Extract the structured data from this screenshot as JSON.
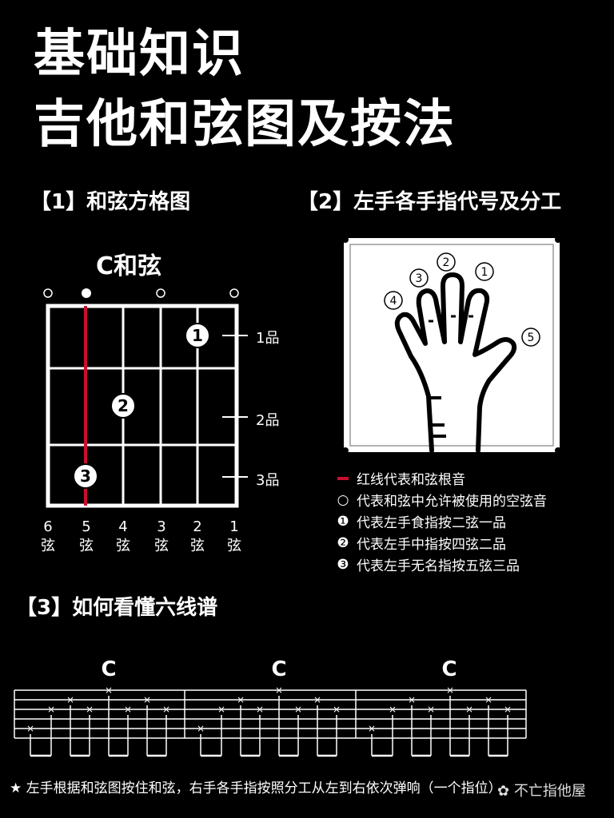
{
  "title": {
    "line1": "基础知识",
    "line2": "吉他和弦图及按法"
  },
  "sections": {
    "s1": "【1】和弦方格图",
    "s2": "【2】左手各手指代号及分工",
    "s3": "【3】如何看懂六线谱"
  },
  "chord": {
    "name": "C和弦",
    "frets": [
      "1品",
      "2品",
      "3品"
    ],
    "strings": [
      {
        "num": "6",
        "label": "弦"
      },
      {
        "num": "5",
        "label": "弦"
      },
      {
        "num": "4",
        "label": "弦"
      },
      {
        "num": "3",
        "label": "弦"
      },
      {
        "num": "2",
        "label": "弦"
      },
      {
        "num": "1",
        "label": "弦"
      }
    ],
    "finger_marks": [
      "1",
      "2",
      "3"
    ]
  },
  "hand": {
    "fingers": [
      "1",
      "2",
      "3",
      "4",
      "5"
    ]
  },
  "legend": [
    {
      "symbol": "red-line",
      "text": "红线代表和弦根音"
    },
    {
      "symbol": "○",
      "text": "代表和弦中允许被使用的空弦音"
    },
    {
      "symbol": "❶",
      "text": "代表左手食指按二弦一品"
    },
    {
      "symbol": "❷",
      "text": "代表左手中指按四弦二品"
    },
    {
      "symbol": "❸",
      "text": "代表左手无名指按五弦三品"
    }
  ],
  "tab": {
    "chords": [
      "C",
      "C",
      "C"
    ]
  },
  "footer": "★ 左手根据和弦图按住和弦，右手各手指按照分工从左到右依次弹响（一个指位）",
  "watermark": "不亡指他屋",
  "colors": {
    "root": "#c8102e",
    "background": "#000000",
    "foreground": "#ffffff"
  }
}
